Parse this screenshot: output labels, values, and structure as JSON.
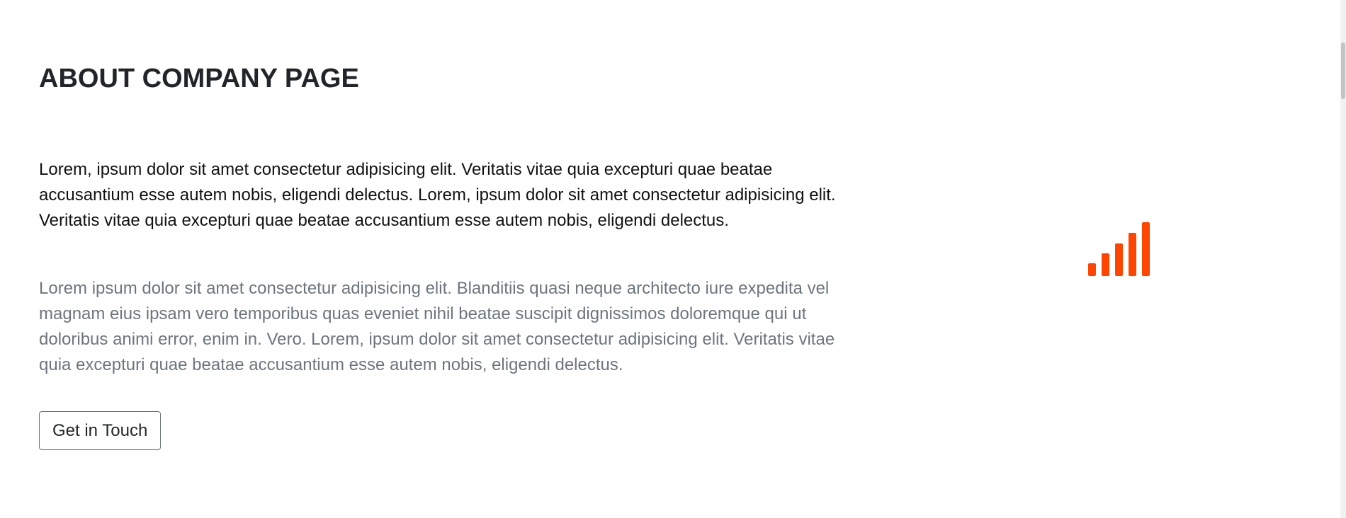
{
  "about": {
    "title": "ABOUT COMPANY PAGE",
    "lead": "Lorem, ipsum dolor sit amet consectetur adipisicing elit. Veritatis vitae quia excepturi quae beatae accusantium esse autem nobis, eligendi delectus. Lorem, ipsum dolor sit amet consectetur adipisicing elit. Veritatis vitae quia excepturi quae beatae accusantium esse autem nobis, eligendi delectus.",
    "body": "Lorem ipsum dolor sit amet consectetur adipisicing elit. Blanditiis quasi neque architecto iure expedita vel magnam eius ipsam vero temporibus quas eveniet nihil beatae suscipit dignissimos doloremque qui ut doloribus animi error, enim in. Vero. Lorem, ipsum dolor sit amet consectetur adipisicing elit. Veritatis vitae quia excepturi quae beatae accusantium esse autem nobis, eligendi delectus.",
    "cta_label": "Get in Touch"
  },
  "graphic": {
    "icon": "signal-bars-icon",
    "color": "#ff4500",
    "bars": 5
  },
  "colors": {
    "heading": "#212529",
    "muted": "#6c757d",
    "accent": "#ff4500"
  }
}
